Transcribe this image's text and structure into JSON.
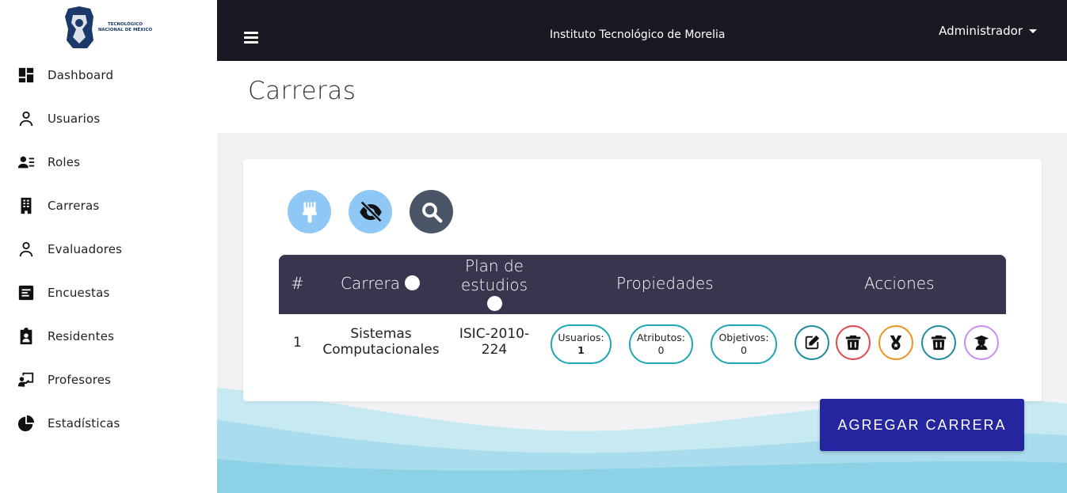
{
  "sidebar": {
    "logo_text": "TECNOLÓGICO NACIONAL DE MÉXICO",
    "items": [
      {
        "label": "Dashboard",
        "icon": "dashboard-icon"
      },
      {
        "label": "Usuarios",
        "icon": "user-icon"
      },
      {
        "label": "Roles",
        "icon": "roles-icon"
      },
      {
        "label": "Carreras",
        "icon": "building-icon"
      },
      {
        "label": "Evaluadores",
        "icon": "user-icon"
      },
      {
        "label": "Encuestas",
        "icon": "survey-icon"
      },
      {
        "label": "Residentes",
        "icon": "clipboard-user-icon"
      },
      {
        "label": "Profesores",
        "icon": "teacher-icon"
      },
      {
        "label": "Estadísticas",
        "icon": "pie-chart-icon"
      }
    ]
  },
  "topbar": {
    "institution": "Instituto Tecnológico de Morelia",
    "user": "Administrador"
  },
  "page": {
    "title": "Carreras"
  },
  "toolbar": {
    "buttons": [
      {
        "icon": "brush-icon",
        "color": "#90c8f5"
      },
      {
        "icon": "eye-slash-icon",
        "color": "#90c8f5"
      },
      {
        "icon": "search-icon",
        "color": "#4a5568"
      }
    ]
  },
  "table": {
    "headers": {
      "num": "#",
      "carrera": "Carrera",
      "plan_line1": "Plan de",
      "plan_line2": "estudios",
      "propiedades": "Propiedades",
      "acciones": "Acciones"
    },
    "rows": [
      {
        "num": "1",
        "carrera_line1": "Sistemas",
        "carrera_line2": "Computacionales",
        "plan_line1": "ISIC-2010-",
        "plan_line2": "224",
        "usuarios_label": "Usuarios:",
        "usuarios_value": "1",
        "atributos_label": "Atributos:",
        "atributos_value": "0",
        "objetivos_label": "Objetivos:",
        "objetivos_value": "0"
      }
    ]
  },
  "actions": [
    {
      "icon": "edit-icon",
      "color": "#1e8ba0"
    },
    {
      "icon": "trash-icon",
      "color": "#e0484d"
    },
    {
      "icon": "medal-icon",
      "color": "#f0921e"
    },
    {
      "icon": "trash-icon",
      "color": "#1e8ba0"
    },
    {
      "icon": "graduate-icon",
      "color": "#c98ef0"
    }
  ],
  "add_button": "AGREGAR CARRERA"
}
